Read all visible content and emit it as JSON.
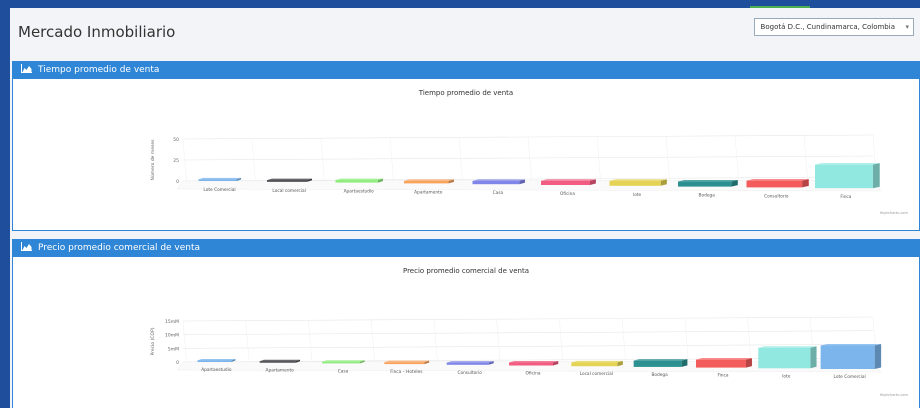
{
  "page": {
    "title": "Mercado Inmobiliario",
    "location": "Bogotá D.C., Cundinamarca, Colombia",
    "credit": "Highcharts.com"
  },
  "panels": [
    {
      "header": "Tiempo promedio de venta"
    },
    {
      "header": "Precio promedio comercial de venta"
    }
  ],
  "chart_data": [
    {
      "type": "bar",
      "title": "Tiempo promedio de venta",
      "ylabel": "Número de meses",
      "ylim": [
        0,
        50
      ],
      "yticks": [
        "0",
        "25",
        "50"
      ],
      "categories": [
        "Lote Comercial",
        "Local comercial",
        "Apartaestudio",
        "Apartamento",
        "Casa",
        "Oficina",
        "lote",
        "Bodega",
        "Consultorio",
        "Finca"
      ],
      "values": [
        2,
        2,
        3,
        3,
        4,
        5,
        6,
        6,
        8,
        28
      ],
      "colors": [
        "#7cb5ec",
        "#434348",
        "#90ed7d",
        "#f7a35c",
        "#8085e9",
        "#f15c80",
        "#e4d354",
        "#2b908f",
        "#f45b5b",
        "#91e8e1"
      ],
      "grid": true,
      "legend": "none"
    },
    {
      "type": "bar",
      "title": "Precio promedio comercial de venta",
      "ylabel": "Precio (COP)",
      "ylim": [
        0,
        15
      ],
      "yticks": [
        "0",
        "5mM",
        "10mM",
        "15mM"
      ],
      "categories": [
        "Apartaestudio",
        "Apartamento",
        "Casa",
        "Finca – Hoteles",
        "Consultorio",
        "Oficina",
        "Local comercial",
        "Bodega",
        "Finca",
        "lote",
        "Lote Comercial"
      ],
      "values": [
        0.3,
        0.4,
        0.6,
        0.7,
        0.8,
        1.1,
        1.4,
        2.3,
        2.9,
        7.5,
        8.6
      ],
      "colors": [
        "#7cb5ec",
        "#434348",
        "#90ed7d",
        "#f7a35c",
        "#8085e9",
        "#f15c80",
        "#e4d354",
        "#2b908f",
        "#f45b5b",
        "#91e8e1",
        "#7cb5ec"
      ],
      "grid": true,
      "legend": "none"
    }
  ]
}
